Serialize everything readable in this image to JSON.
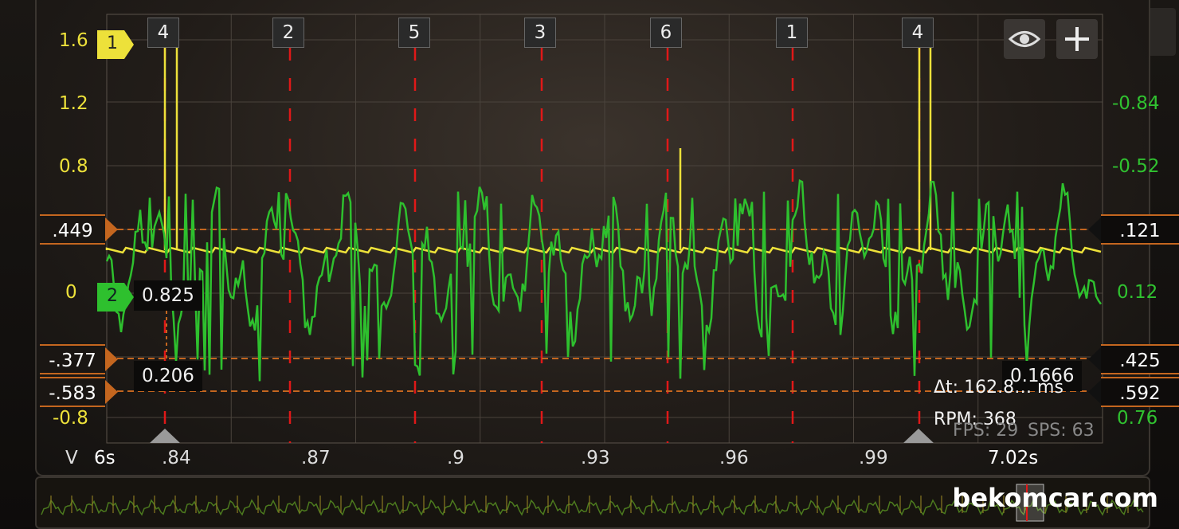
{
  "scope": {
    "channel1": {
      "number": "1",
      "color": "#ede13a"
    },
    "channel2": {
      "number": "2",
      "color": "#2ec02e"
    },
    "left_axis": [
      "1.6",
      "1.2",
      "0.8",
      "0",
      "-0.8"
    ],
    "right_axis": [
      "-0.84",
      "-0.52",
      "0.12",
      "0.76"
    ],
    "left_markers": [
      ".449",
      "-.377",
      "-.583"
    ],
    "right_markers": [
      ".121",
      ".425",
      ".592"
    ],
    "cursor_values": {
      "a_top": "0.825",
      "a_bottom": "0.206",
      "b": "0.1666"
    },
    "cylinders": [
      "4",
      "2",
      "5",
      "3",
      "6",
      "1",
      "4"
    ],
    "x_axis": {
      "unit": "V",
      "start": "6s",
      "ticks": [
        ".84",
        ".87",
        ".9",
        ".93",
        ".96",
        ".99"
      ],
      "end": "7.02s"
    },
    "measure": {
      "dt": "Δt: 162.8… ms",
      "rpm": "RPM: 368"
    },
    "stats": {
      "fps": "FPS: 29",
      "sps": "SPS: 63"
    },
    "icons": {
      "visibility": "eye-icon",
      "add": "plus-icon"
    }
  },
  "watermark": "bekomcar.com"
}
